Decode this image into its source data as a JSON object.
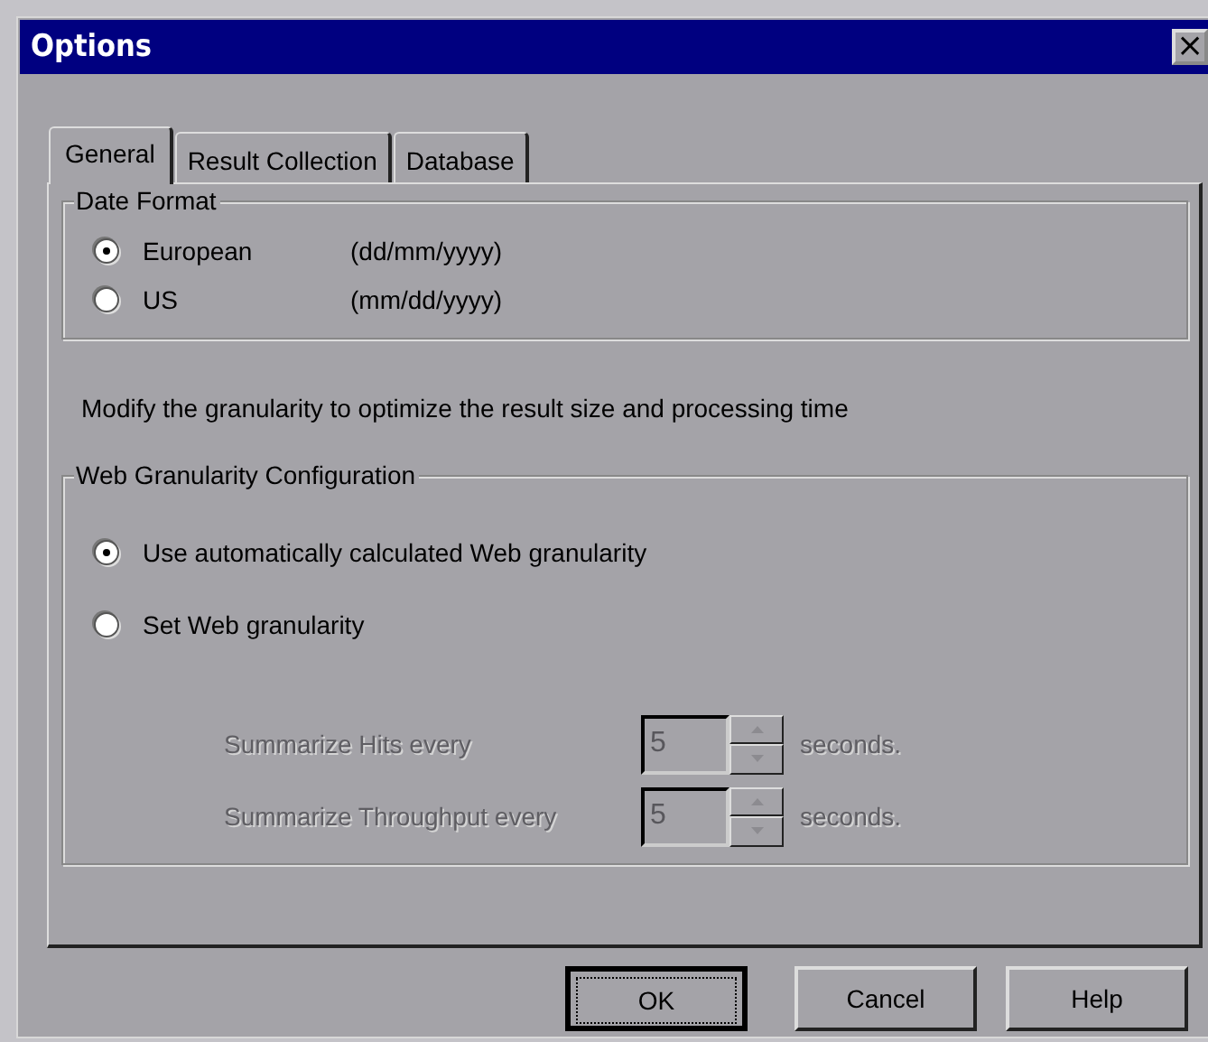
{
  "window": {
    "title": "Options",
    "close": "×"
  },
  "tabs": [
    {
      "label": "General",
      "selected": true
    },
    {
      "label": "Result Collection",
      "selected": false
    },
    {
      "label": "Database",
      "selected": false
    }
  ],
  "date_format": {
    "title": "Date Format",
    "options": [
      {
        "label": "European",
        "pattern": "(dd/mm/yyyy)",
        "selected": true
      },
      {
        "label": "US",
        "pattern": "(mm/dd/yyyy)",
        "selected": false
      }
    ]
  },
  "hint": "Modify the granularity to optimize the result size and processing time",
  "web_granularity": {
    "title": "Web Granularity Configuration",
    "options": [
      {
        "label": "Use automatically calculated Web granularity",
        "selected": true
      },
      {
        "label": "Set Web granularity",
        "selected": false
      }
    ],
    "fields": [
      {
        "label": "Summarize Hits every",
        "value": "5",
        "unit": "seconds.",
        "disabled": true
      },
      {
        "label": "Summarize Throughput every",
        "value": "5",
        "unit": "seconds.",
        "disabled": true
      }
    ]
  },
  "buttons": [
    {
      "label": "OK",
      "default": true
    },
    {
      "label": "Cancel",
      "default": false
    },
    {
      "label": "Help",
      "default": false
    }
  ]
}
